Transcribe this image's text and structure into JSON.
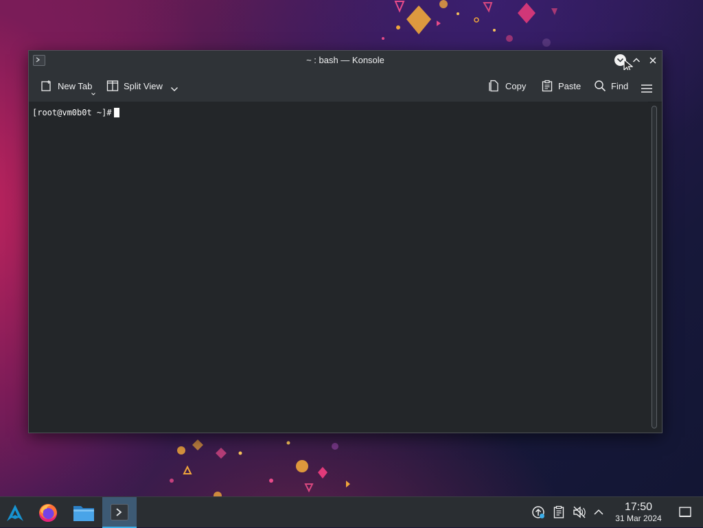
{
  "window": {
    "title": "~ : bash — Konsole"
  },
  "toolbar": {
    "new_tab_label": "New Tab",
    "split_view_label": "Split View",
    "copy_label": "Copy",
    "paste_label": "Paste",
    "find_label": "Find"
  },
  "terminal": {
    "prompt": "[root@vm0b0t ~]#"
  },
  "taskbar": {
    "apps": [
      "application-launcher-icon",
      "firefox-icon",
      "file-manager-icon",
      "konsole-icon"
    ],
    "active_app": "konsole-icon",
    "tray_icons": [
      "update-notifier-icon",
      "clipboard-icon",
      "volume-muted-icon",
      "expand-tray-icon"
    ]
  },
  "clock": {
    "time": "17:50",
    "date": "31 Mar 2024"
  },
  "colors": {
    "accent": "#3daee9",
    "window_bg": "#232629",
    "titlebar_bg": "#2f3337",
    "taskbar_bg": "#2a2e32"
  }
}
